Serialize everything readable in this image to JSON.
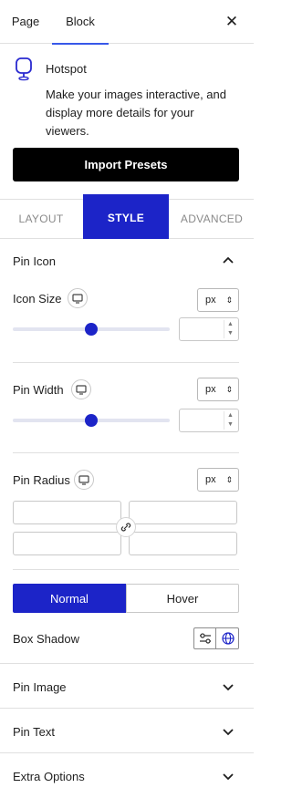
{
  "top_tabs": {
    "page": "Page",
    "block": "Block",
    "close_glyph": "✕"
  },
  "block_card": {
    "icon": "pin-marker-icon",
    "title": "Hotspot",
    "description": "Make your images interactive, and display more details for your viewers.",
    "import_button": "Import Presets"
  },
  "sub_tabs": {
    "layout": "LAYOUT",
    "style": "STYLE",
    "advanced": "ADVANCED"
  },
  "pin_icon": {
    "title": "Pin Icon",
    "icon_size": {
      "label": "Icon Size",
      "unit": "px",
      "value": ""
    },
    "pin_width": {
      "label": "Pin Width",
      "unit": "px",
      "value": ""
    },
    "pin_radius": {
      "label": "Pin Radius",
      "unit": "px"
    },
    "state_toggle": {
      "normal": "Normal",
      "hover": "Hover"
    },
    "box_shadow": {
      "label": "Box Shadow"
    }
  },
  "collapsed_sections": {
    "pin_image": "Pin Image",
    "pin_text": "Pin Text",
    "extra_options": "Extra Options"
  },
  "colors": {
    "accent": "#1c24c8",
    "wp_blue": "#3858e9",
    "button_dark": "#000000"
  }
}
